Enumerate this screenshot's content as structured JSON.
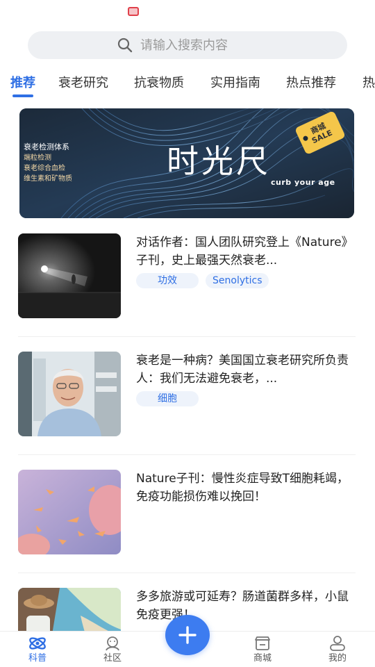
{
  "search": {
    "placeholder": "请输入搜索内容"
  },
  "tabs": [
    {
      "label": "推荐",
      "active": true
    },
    {
      "label": "衰老研究"
    },
    {
      "label": "抗衰物质"
    },
    {
      "label": "实用指南"
    },
    {
      "label": "热点推荐"
    },
    {
      "label": "热"
    }
  ],
  "banner": {
    "list": [
      "衰老检测体系",
      "端粒检测",
      "衰老综合血检",
      "维生素和矿物质"
    ],
    "title": "时光尺",
    "subtitle": "curb your age",
    "tag_line1": "商城",
    "tag_line2": "SALE"
  },
  "articles": [
    {
      "title": "对话作者：国人团队研究登上《Nature》子刊，史上最强天然衰老...",
      "tags": [
        "功效",
        "Senolytics"
      ]
    },
    {
      "title": "衰老是一种病？美国国立衰老研究所负责人：我们无法避免衰老，...",
      "tags": [
        "细胞"
      ]
    },
    {
      "title": "Nature子刊：慢性炎症导致T细胞耗竭，免疫功能损伤难以挽回！",
      "tags": []
    },
    {
      "title": "多多旅游或可延寿？肠道菌群多样，小鼠免疫更强！",
      "tags": []
    }
  ],
  "nav": [
    {
      "label": "科普",
      "icon": "science-icon",
      "active": true
    },
    {
      "label": "社区",
      "icon": "community-icon"
    },
    {
      "label": "商城",
      "icon": "store-icon"
    },
    {
      "label": "我的",
      "icon": "profile-icon"
    }
  ],
  "colors": {
    "accent": "#2f6fe4",
    "fab": "#3d7cf0",
    "tag_bg": "#eef3fb",
    "banner_bg": "#1a2735",
    "sale_tag": "#f4c64a"
  }
}
